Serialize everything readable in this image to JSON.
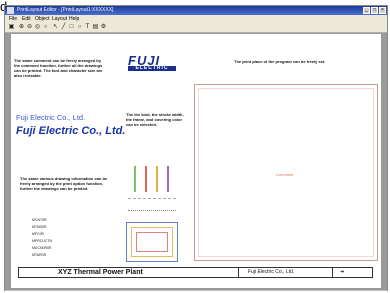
{
  "overlay_text": "d",
  "window": {
    "title": "PrintLayout Editor - [PrintLayout1:XXXXXX]",
    "controls": [
      "_",
      "□",
      "×"
    ]
  },
  "menu": [
    "File",
    "Edit",
    "Object",
    "Layout",
    "Help"
  ],
  "toolbar": [
    "floppy-icon",
    "zoom-in-icon",
    "zoom-out-icon",
    "zoom-fit-icon",
    "zoom-icon",
    "pointer-icon",
    "line-icon",
    "rectangle-icon",
    "ellipse-icon",
    "text-icon",
    "image-icon",
    "settings-icon"
  ],
  "sheet": {
    "note_comment": "The same comment can be freely arranged by the comment function, further all the drawings can be printed. The font and character size are also revisable.",
    "note_print_place": "The print place of the program can be freely set.",
    "note_lines": "The the kind, the stroke width, the frame, and covering color can be selected.",
    "note_drawing": "The same various drawing information can be freely arranged by the print option function, further the drawings can be printed.",
    "company_small": "Fuji Electric Co., Ltd.",
    "company_large": "Fuji Electric Co., Ltd.",
    "logo_main": "FUJI",
    "logo_sub": "ELECTRIC",
    "center_label": "Comment",
    "list_items": [
      "MCNT0R",
      "MTN0DR",
      "MFC0R",
      "MPRCUCTN",
      "MDCN0R0R",
      "MTAR0R"
    ],
    "title_block": {
      "plant_name": "XYZ Thermal Power Plant",
      "company": "Fuji Electric Co., Ltd.",
      "arrow": "➜"
    },
    "line_colors": [
      "#7cc06a",
      "#e06a5a",
      "#d8b04a",
      "#9a6ac0"
    ]
  }
}
